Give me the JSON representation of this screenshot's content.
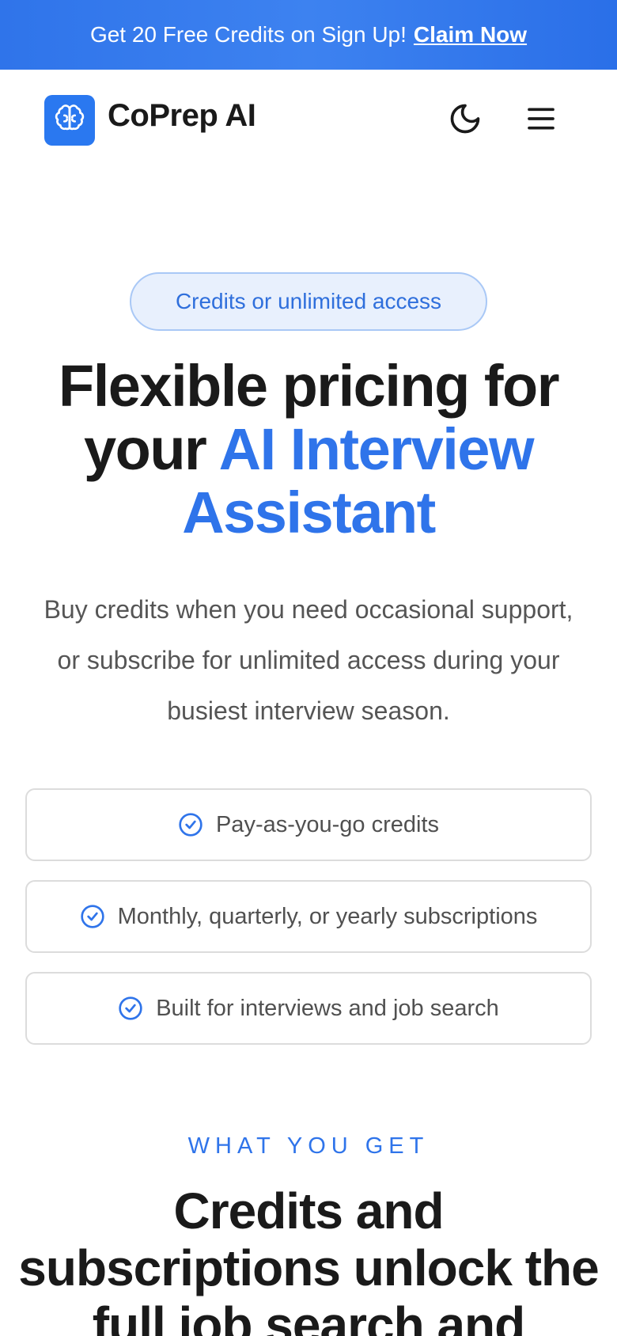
{
  "promo": {
    "text": "Get 20 Free Credits on Sign Up!",
    "link": "Claim Now"
  },
  "nav": {
    "brand": "CoPrep AI",
    "logo_icon": "brain-icon",
    "theme_icon": "moon-icon",
    "menu_icon": "hamburger-menu-icon"
  },
  "hero": {
    "pill": "Credits or unlimited access",
    "title_part1": "Flexible pricing for your ",
    "title_accent": "AI Interview Assistant",
    "subtitle": "Buy credits when you need occasional support, or subscribe for unlimited access during your busiest interview season."
  },
  "features": [
    {
      "label": "Pay-as-you-go credits",
      "icon": "check-circle-icon"
    },
    {
      "label": "Monthly, quarterly, or yearly subscriptions",
      "icon": "check-circle-icon"
    },
    {
      "label": "Built for interviews and job search",
      "icon": "check-circle-icon"
    }
  ],
  "section": {
    "eyebrow": "WHAT YOU GET",
    "title": "Credits and subscriptions unlock the full job search and"
  },
  "colors": {
    "accent": "#2f74ea",
    "promo_bg": "#3d82f0",
    "pill_bg": "#e8f0fd",
    "text_dark": "#1a1a1a",
    "text_muted": "#555555"
  }
}
